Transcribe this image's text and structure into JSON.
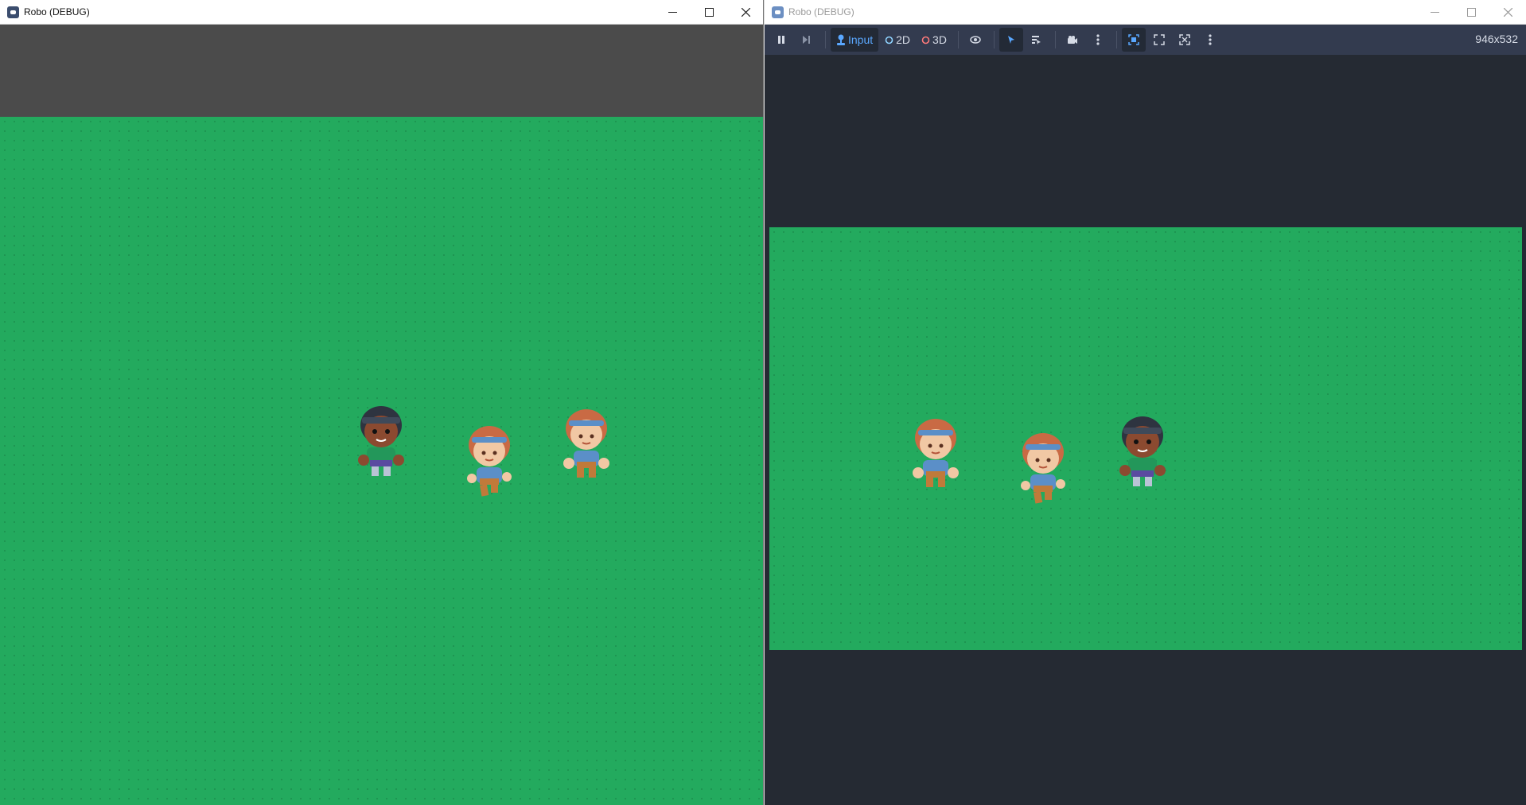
{
  "left_window": {
    "title": "Robo (DEBUG)",
    "controls": {
      "minimize": "minimize-icon",
      "maximize": "maximize-icon",
      "close": "close-icon"
    }
  },
  "right_window": {
    "title": "Robo (DEBUG)",
    "toolbar": {
      "input_label": "Input",
      "mode_2d_label": "2D",
      "mode_3d_label": "3D",
      "resolution": "946x532"
    }
  },
  "colors": {
    "grass": "#23aa5e",
    "editor_bg": "#252a33",
    "toolbar_bg": "#333b4f",
    "accent": "#5aa8ff"
  },
  "characters": [
    {
      "name": "dark-haired-girl",
      "hair": "#2e3440",
      "skin": "#8b4a30",
      "shirt": "#23975a",
      "pants": "#5a4aa0"
    },
    {
      "name": "redhead-girl-walking",
      "hair": "#c96a44",
      "skin": "#f1c8a4",
      "shirt": "#5b8fc8",
      "pants": "#c07a3a"
    },
    {
      "name": "redhead-boy",
      "hair": "#c96a44",
      "skin": "#f1c8a4",
      "shirt": "#5b8fc8",
      "pants": "#c07a3a"
    }
  ]
}
